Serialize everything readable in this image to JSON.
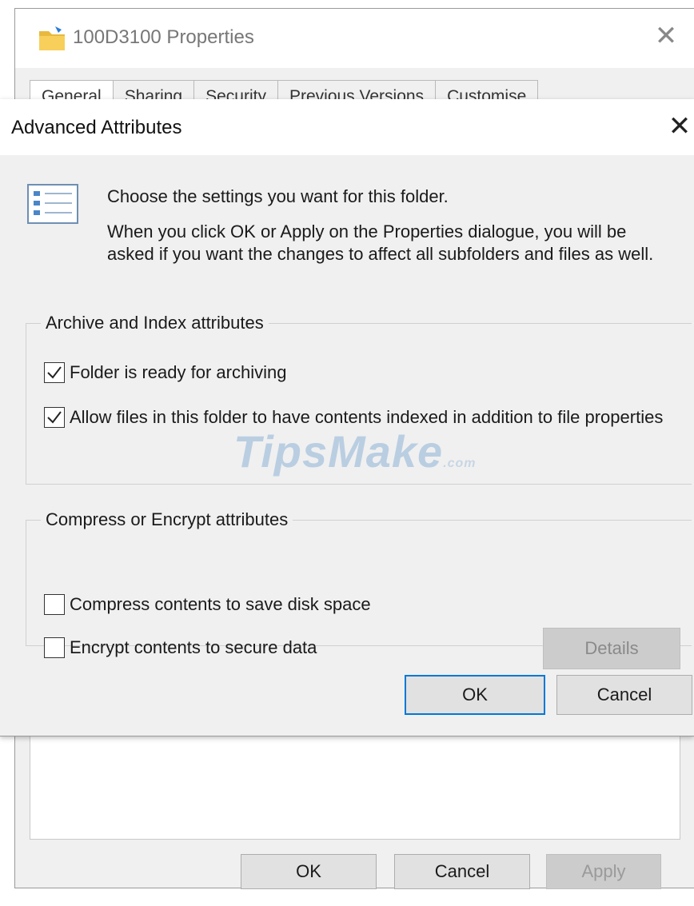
{
  "properties_dialog": {
    "title": "100D3100 Properties",
    "tabs": [
      "General",
      "Sharing",
      "Security",
      "Previous Versions",
      "Customise"
    ],
    "buttons": {
      "ok": "OK",
      "cancel": "Cancel",
      "apply": "Apply"
    }
  },
  "advanced_dialog": {
    "title": "Advanced Attributes",
    "intro_line1": "Choose the settings you want for this folder.",
    "intro_line2": "When you click OK or Apply on the Properties dialogue, you will be asked if you want the changes to affect all subfolders and files as well.",
    "archive_group": {
      "legend": "Archive and Index attributes",
      "folder_ready": {
        "label": "Folder is ready for archiving",
        "checked": true
      },
      "allow_index": {
        "label": "Allow files in this folder to have contents indexed in addition to file properties",
        "checked": true
      }
    },
    "compress_group": {
      "legend": "Compress or Encrypt attributes",
      "compress": {
        "label": "Compress contents to save disk space",
        "checked": false
      },
      "encrypt": {
        "label": "Encrypt contents to secure data",
        "checked": false
      },
      "details_label": "Details"
    },
    "buttons": {
      "ok": "OK",
      "cancel": "Cancel"
    }
  },
  "watermark": {
    "main": "TipsMake",
    "tail": ".com"
  },
  "colors": {
    "focus_border": "#0078d7",
    "dialog_bg": "#f0f0f0",
    "disabled_text": "#8a8a8a"
  }
}
